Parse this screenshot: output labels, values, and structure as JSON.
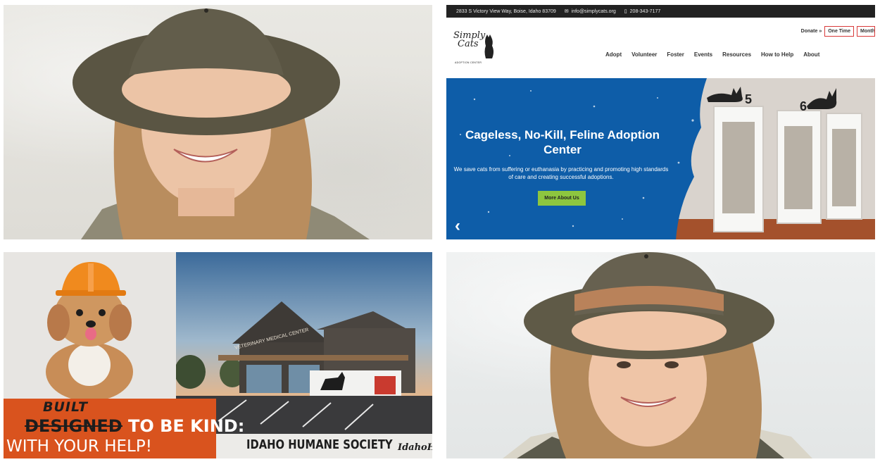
{
  "tiles": {
    "top_left": {
      "kind": "photo"
    },
    "top_right": {
      "kind": "website-screenshot",
      "topbar": {
        "address": "2833 S Victory View Way, Boise, Idaho 83709",
        "email": "info@simplycats.org",
        "phone": "208-343-7177"
      },
      "logo": {
        "line1": "Simply",
        "line2": "Cats",
        "tagline": "ADOPTION CENTER"
      },
      "donate": {
        "label": "Donate »",
        "buttons": [
          "One Time",
          "Monthly"
        ]
      },
      "nav": [
        "Adopt",
        "Volunteer",
        "Foster",
        "Events",
        "Resources",
        "How to Help",
        "About"
      ],
      "hero": {
        "title": "Cageless, No-Kill, Feline Adoption Center",
        "text": "We save cats from suffering or euthanasia by practicing and promoting high standards of care and creating successful adoptions.",
        "button": "More About Us",
        "door_numbers": [
          "5",
          "6"
        ],
        "prev_arrow": "‹"
      },
      "colors": {
        "hero_blue": "#0e5da8",
        "button_green": "#8dc63f",
        "topbar": "#222222",
        "donate_border": "#d83a3a"
      }
    },
    "bottom_left": {
      "kind": "promo-graphic",
      "built": "BUILT",
      "struck": "DESIGNED",
      "line1_rest": " TO BE KIND:",
      "line2": "WITH YOUR HELP!",
      "building_sign": "VETERINARY MEDICAL CENTER",
      "org_name": "IDAHO HUMANE SOCIETY",
      "url_fragment": "IdahoH",
      "colors": {
        "orange": "#d9531e"
      }
    },
    "bottom_right": {
      "kind": "photo"
    }
  }
}
